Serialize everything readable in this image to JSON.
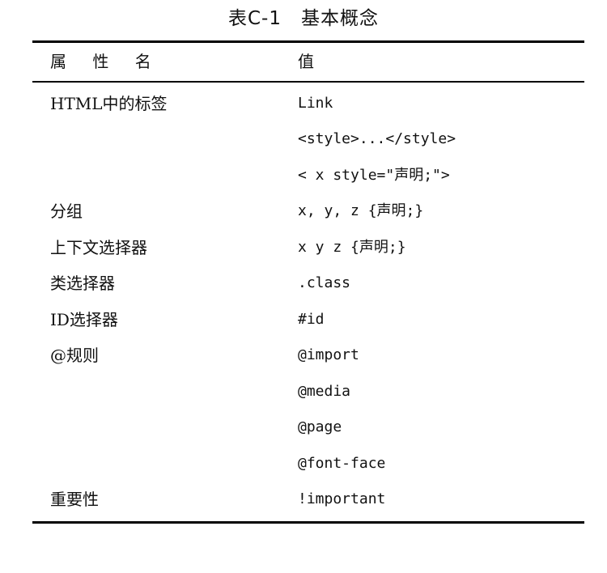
{
  "caption": "表C-1　基本概念",
  "header": {
    "name_col": "属 性 名",
    "value_col": "值"
  },
  "rows": [
    {
      "name": "HTML中的标签",
      "value": "Link"
    },
    {
      "name": "",
      "value": "<style>...</style>"
    },
    {
      "name": "",
      "value": "< x style=\"声明;\">"
    },
    {
      "name": "分组",
      "value": "x, y, z {声明;}"
    },
    {
      "name": "上下文选择器",
      "value": "x y z {声明;}"
    },
    {
      "name": "类选择器",
      "value": ".class"
    },
    {
      "name": "ID选择器",
      "value": "#id"
    },
    {
      "name": "@规则",
      "value": "@import"
    },
    {
      "name": "",
      "value": "@media"
    },
    {
      "name": "",
      "value": "@page"
    },
    {
      "name": "",
      "value": "@font-face"
    },
    {
      "name": "重要性",
      "value": "!important"
    }
  ]
}
